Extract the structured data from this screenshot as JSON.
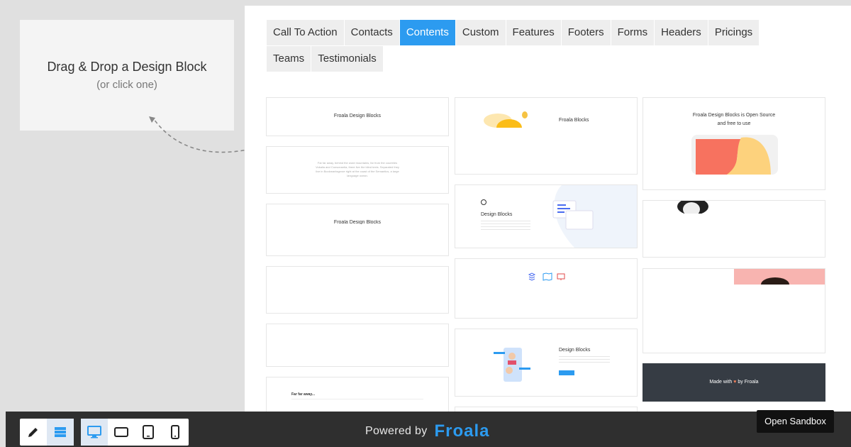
{
  "dropzone": {
    "title": "Drag & Drop a Design Block",
    "subtitle": "(or click one)"
  },
  "tabs": [
    {
      "label": "Call To Action",
      "active": false
    },
    {
      "label": "Contacts",
      "active": false
    },
    {
      "label": "Contents",
      "active": true
    },
    {
      "label": "Custom",
      "active": false
    },
    {
      "label": "Features",
      "active": false
    },
    {
      "label": "Footers",
      "active": false
    },
    {
      "label": "Forms",
      "active": false
    },
    {
      "label": "Headers",
      "active": false
    },
    {
      "label": "Pricings",
      "active": false
    },
    {
      "label": "Teams",
      "active": false
    },
    {
      "label": "Testimonials",
      "active": false
    }
  ],
  "thumbnails": {
    "c1_title": "Froala Design Blocks",
    "c1_paragraph": "Far far away, behind the word mountains, far from the countries Vokalia and Consonantia, there live the blind texts. Separated they live in Bookmarksgrove right at the coast of the Semantics, a large language ocean.",
    "c1_title2": "Froala Design Blocks",
    "c1_far": "Far far away...",
    "c2_brand": "Froala Blocks",
    "c2_design": "Design Blocks",
    "c2_design2": "Design Blocks",
    "c3_open": "Froala Design Blocks is Open Source",
    "c3_free": "and free to use",
    "c3_made_pre": "Made with",
    "c3_made_post": "by Froala"
  },
  "colors": {
    "accent": "#2c9bf0",
    "bar": "#2f2f2f",
    "dark_card": "#363c44"
  },
  "toolbar": {
    "edit_icon": "pencil-icon",
    "blocks_icon": "blocks-list-icon",
    "devices": [
      "desktop-icon",
      "tablet-landscape-icon",
      "tablet-icon",
      "phone-icon"
    ]
  },
  "footer": {
    "powered": "Powered by",
    "brand": "Froala"
  },
  "sandbox_label": "Open Sandbox"
}
